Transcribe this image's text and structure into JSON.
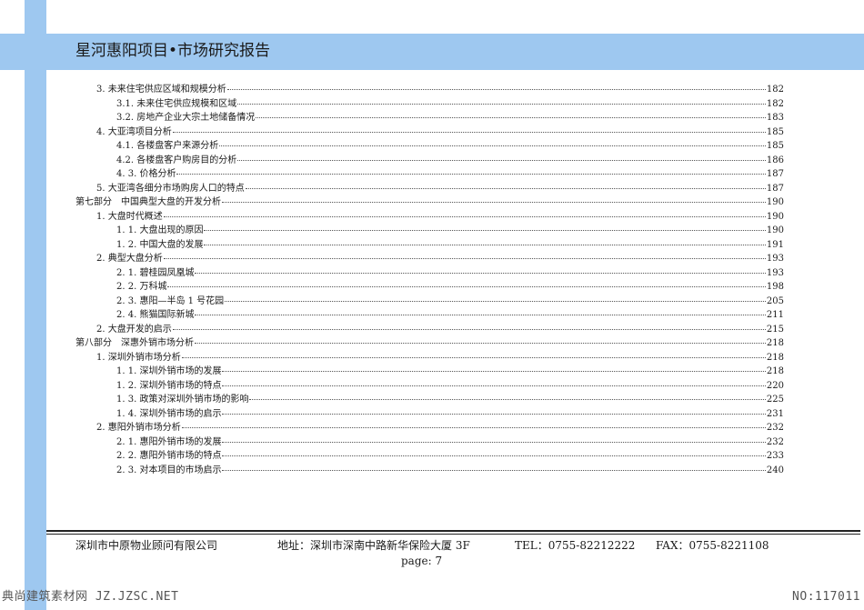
{
  "header": {
    "title": "星河惠阳项目•市场研究报告"
  },
  "toc": [
    {
      "text": "3. 未来住宅供应区域和规模分析",
      "page": "182",
      "level": 1
    },
    {
      "text": "3.1. 未来住宅供应规模和区域",
      "page": "182",
      "level": 2
    },
    {
      "text": "3.2. 房地产企业大宗土地储备情况",
      "page": "183",
      "level": 2
    },
    {
      "text": "4. 大亚湾项目分析",
      "page": "185",
      "level": 1
    },
    {
      "text": "4.1. 各楼盘客户来源分析",
      "page": "185",
      "level": 2
    },
    {
      "text": "4.2. 各楼盘客户购房目的分析",
      "page": "186",
      "level": 2
    },
    {
      "text": "4. 3. 价格分析",
      "page": "187",
      "level": 2
    },
    {
      "text": "5. 大亚湾各细分市场购房人口的特点",
      "page": "187",
      "level": 1
    },
    {
      "text": "第七部分　中国典型大盘的开发分析",
      "page": "190",
      "level": 0
    },
    {
      "text": "1. 大盘时代概述",
      "page": "190",
      "level": 1
    },
    {
      "text": "1. 1. 大盘出现的原因",
      "page": "190",
      "level": 2
    },
    {
      "text": "1. 2. 中国大盘的发展",
      "page": "191",
      "level": 2
    },
    {
      "text": "2. 典型大盘分析",
      "page": "193",
      "level": 1
    },
    {
      "text": "2. 1. 碧桂园凤凰城",
      "page": "193",
      "level": 2
    },
    {
      "text": "2. 2. 万科城",
      "page": "198",
      "level": 2
    },
    {
      "text": "2. 3. 惠阳—半岛 1 号花园",
      "page": "205",
      "level": 2
    },
    {
      "text": "2. 4. 熊猫国际新城",
      "page": "211",
      "level": 2
    },
    {
      "text": "2. 大盘开发的启示",
      "page": "215",
      "level": 1
    },
    {
      "text": "第八部分　深惠外销市场分析",
      "page": "218",
      "level": 0
    },
    {
      "text": "1. 深圳外销市场分析",
      "page": "218",
      "level": 1
    },
    {
      "text": "1. 1. 深圳外销市场的发展",
      "page": "218",
      "level": 2
    },
    {
      "text": "1. 2. 深圳外销市场的特点",
      "page": "220",
      "level": 2
    },
    {
      "text": "1. 3. 政策对深圳外销市场的影响",
      "page": "225",
      "level": 2
    },
    {
      "text": "1. 4. 深圳外销市场的启示",
      "page": "231",
      "level": 2
    },
    {
      "text": "2. 惠阳外销市场分析",
      "page": "232",
      "level": 1
    },
    {
      "text": "2. 1. 惠阳外销市场的发展",
      "page": "232",
      "level": 2
    },
    {
      "text": "2. 2. 惠阳外销市场的特点",
      "page": "233",
      "level": 2
    },
    {
      "text": "2. 3. 对本项目的市场启示",
      "page": "240",
      "level": 2
    }
  ],
  "footer": {
    "company": "深圳市中原物业顾问有限公司",
    "address": "地址：深圳市深南中路新华保险大厦 3F",
    "tel": "TEL：0755-82212222",
    "fax": "FAX：0755-8221108",
    "page": "page:  7"
  },
  "watermark": {
    "left": "典尚建筑素材网 JZ.JZSC.NET",
    "right": "NO:117011"
  }
}
